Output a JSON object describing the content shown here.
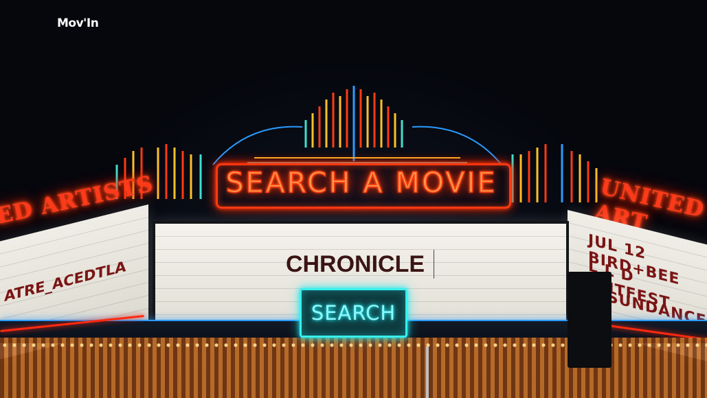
{
  "app": {
    "logo": "Mov'In"
  },
  "hero": {
    "headline": "SEARCH A MOVIE"
  },
  "search": {
    "value": "CHRONICLE",
    "placeholder": "",
    "button_label": "SEARCH"
  },
  "marquee": {
    "left_sign": "ED ARTISTS",
    "right_sign": "UNITED ART",
    "left_board_text": "ATRE_ACEDTLA",
    "right_board_lines": [
      "JUL 12 BIRD+BEE",
      "L L D OUTFEST",
      "G SUNDANCE"
    ]
  },
  "colors": {
    "neon_red": "#ff3a12",
    "neon_cyan": "#38f0ee",
    "board": "#f2f0e9",
    "background": "#05070d"
  }
}
